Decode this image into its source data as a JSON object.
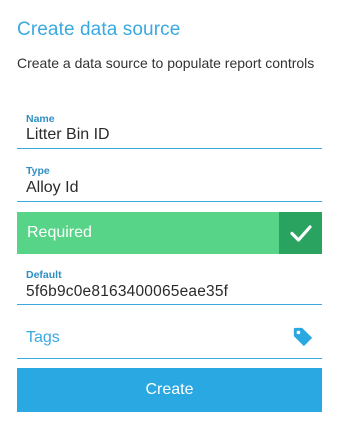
{
  "header": {
    "title": "Create data source",
    "subtitle": "Create a data source to populate report controls"
  },
  "form": {
    "name": {
      "label": "Name",
      "value": "Litter Bin ID"
    },
    "type": {
      "label": "Type",
      "value": "Alloy Id"
    },
    "required": {
      "label": "Required",
      "checked": true,
      "icon": "check-icon"
    },
    "default": {
      "label": "Default",
      "value": "5f6b9c0e8163400065eae35f"
    },
    "tags": {
      "placeholder": "Tags",
      "icon": "tag-icon"
    }
  },
  "actions": {
    "create_label": "Create"
  },
  "colors": {
    "accent": "#3aa9e0",
    "button": "#2aa8e2",
    "toggle_on": "#57d487",
    "toggle_check_bg": "#2ba360"
  }
}
